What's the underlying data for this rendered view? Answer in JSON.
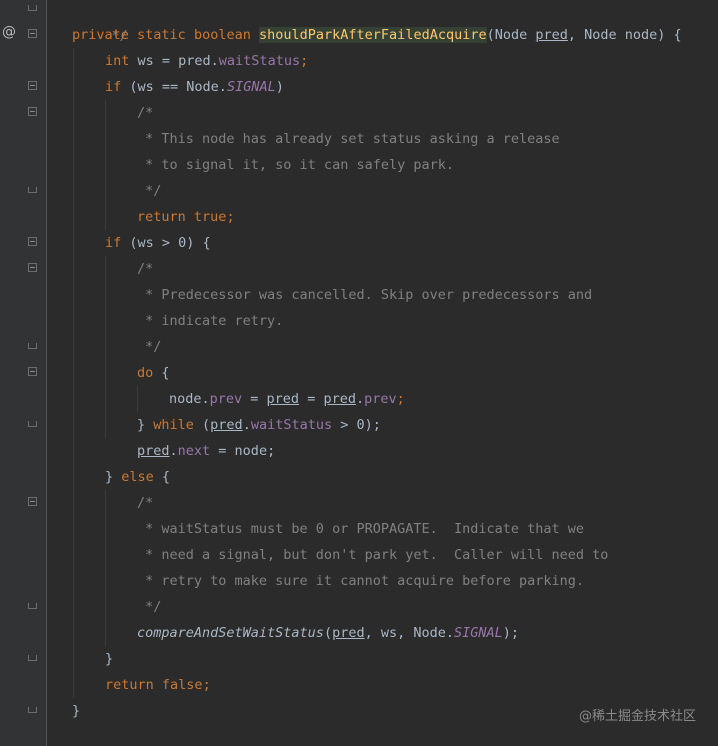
{
  "gutter": {
    "override_marker": "@"
  },
  "code": {
    "line_0": {
      "comment_end": "*/"
    },
    "line_1": {
      "kw_private": "private",
      "kw_static": "static",
      "kw_boolean": "boolean",
      "method_name": "shouldParkAfterFailedAcquire",
      "params_open": "(Node ",
      "param_pred": "pred",
      "params_rest": ", Node node) {"
    },
    "line_2": {
      "kw_int": "int",
      "text1": " ws = pred.",
      "field": "waitStatus",
      "semi": ";"
    },
    "line_3": {
      "kw_if": "if",
      "text1": " (ws == Node.",
      "static_field": "SIGNAL",
      "text2": ")"
    },
    "line_4": {
      "comment": "/*"
    },
    "line_5": {
      "comment": " * This node has already set status asking a release"
    },
    "line_6": {
      "comment": " * to signal it, so it can safely park."
    },
    "line_7": {
      "comment": " */"
    },
    "line_8": {
      "kw_return": "return",
      "kw_true": "true",
      "semi": ";"
    },
    "line_9": {
      "kw_if": "if",
      "text1": " (ws > 0) {"
    },
    "line_10": {
      "comment": "/*"
    },
    "line_11": {
      "comment": " * Predecessor was cancelled. Skip over predecessors and"
    },
    "line_12": {
      "comment": " * indicate retry."
    },
    "line_13": {
      "comment": " */"
    },
    "line_14": {
      "kw_do": "do",
      "text1": " {"
    },
    "line_15": {
      "text1": "node.",
      "field_prev1": "prev",
      "text2": " = ",
      "var_pred1": "pred",
      "text3": " = ",
      "var_pred2": "pred",
      "text4": ".",
      "field_prev2": "prev",
      "semi": ";"
    },
    "line_16": {
      "text1": "} ",
      "kw_while": "while",
      "text2": " (",
      "var_pred": "pred",
      "text3": ".",
      "field": "waitStatus",
      "text4": " > 0);"
    },
    "line_17": {
      "var_pred": "pred",
      "text1": ".",
      "field": "next",
      "text2": " = node;"
    },
    "line_18": {
      "text1": "} ",
      "kw_else": "else",
      "text2": " {"
    },
    "line_19": {
      "comment": "/*"
    },
    "line_20": {
      "comment": " * waitStatus must be 0 or PROPAGATE.  Indicate that we"
    },
    "line_21": {
      "comment": " * need a signal, but don't park yet.  Caller will need to"
    },
    "line_22": {
      "comment": " * retry to make sure it cannot acquire before parking."
    },
    "line_23": {
      "comment": " */"
    },
    "line_24": {
      "method": "compareAndSetWaitStatus",
      "text1": "(",
      "var_pred": "pred",
      "text2": ", ws, Node.",
      "static_field": "SIGNAL",
      "text3": ");"
    },
    "line_25": {
      "text1": "}"
    },
    "line_26": {
      "kw_return": "return",
      "kw_false": "false",
      "semi": ";"
    },
    "line_27": {
      "text1": "}"
    }
  },
  "watermark": "@稀土掘金技术社区",
  "colors": {
    "background": "#2b2b2b",
    "gutter": "#313335",
    "keyword": "#cc7832",
    "method_decl": "#ffc66d",
    "comment": "#808080",
    "field": "#9876aa",
    "default_text": "#a9b7c6"
  }
}
